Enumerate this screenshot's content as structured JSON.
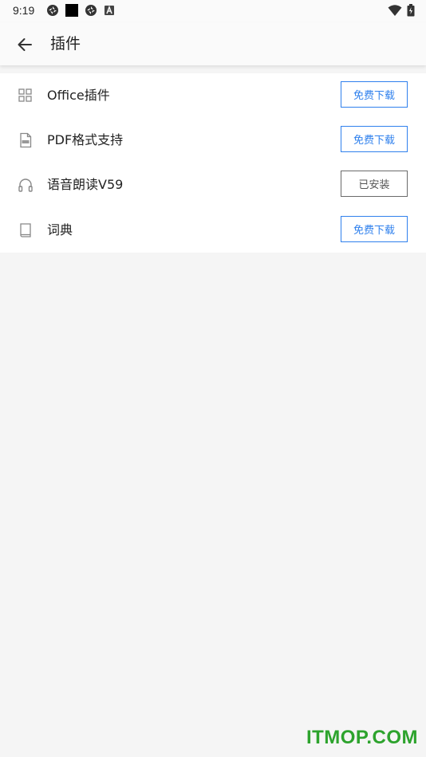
{
  "status_bar": {
    "time": "9:19",
    "left_icons": [
      "aperture-icon",
      "black-square-icon",
      "aperture-icon",
      "a-badge-icon"
    ],
    "right_icons": [
      "wifi-icon",
      "battery-icon"
    ]
  },
  "app_bar": {
    "title": "插件",
    "back_icon": "arrow-left-icon"
  },
  "plugins": [
    {
      "name": "Office插件",
      "icon": "office-grid-icon",
      "button": "免费下载",
      "state": "download"
    },
    {
      "name": "PDF格式支持",
      "icon": "pdf-file-icon",
      "button": "免费下载",
      "state": "download"
    },
    {
      "name": "语音朗读V59",
      "icon": "headphones-icon",
      "button": "已安装",
      "state": "installed"
    },
    {
      "name": "词典",
      "icon": "book-icon",
      "button": "免费下载",
      "state": "download"
    }
  ],
  "colors": {
    "accent": "#2f80ed",
    "installed_border": "#6a6a6a",
    "background": "#f5f5f5",
    "list_background": "#ffffff"
  },
  "watermark": "ITMOP.COM"
}
